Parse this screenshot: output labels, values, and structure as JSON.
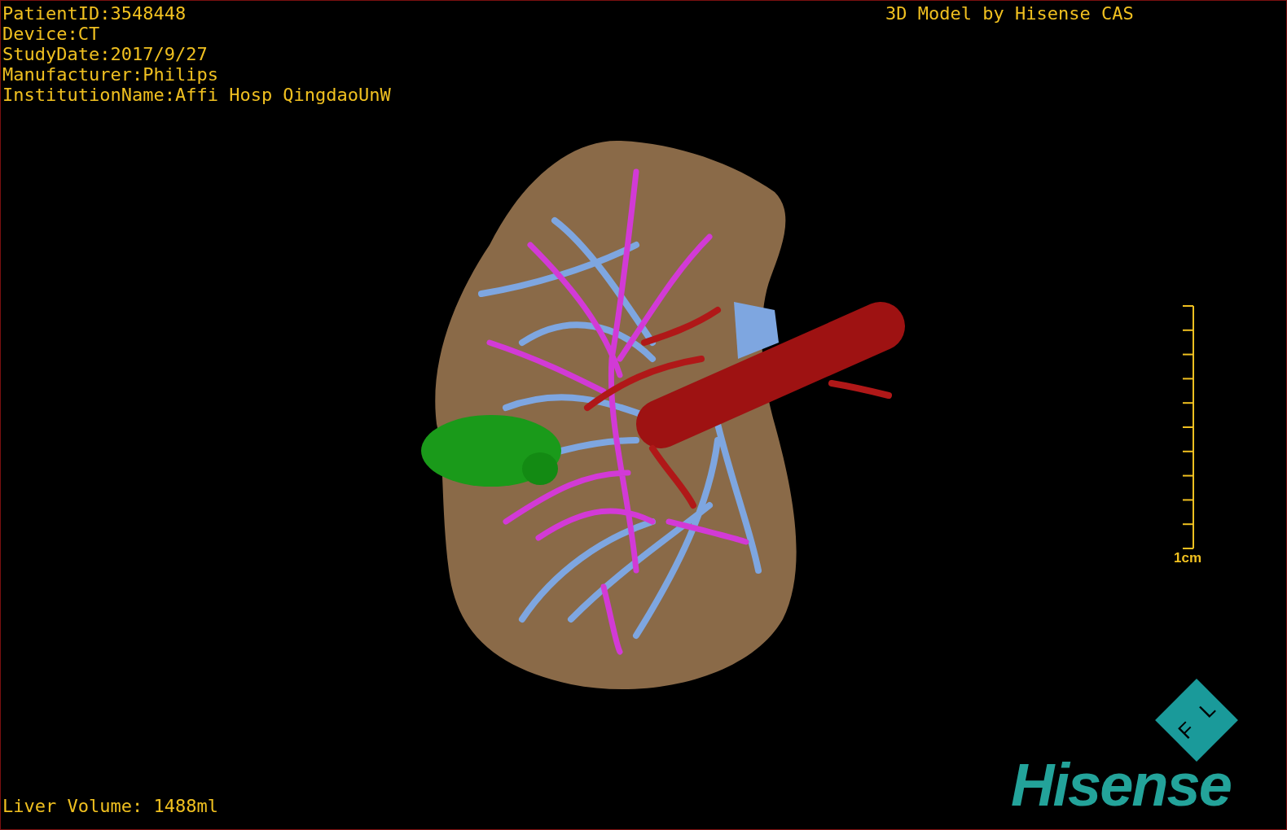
{
  "patient_info": [
    "PatientID:3548448",
    "Device:CT",
    "StudyDate:2017/9/27",
    "Manufacturer:Philips",
    "InstitutionName:Affi Hosp QingdaoUnW"
  ],
  "title": "3D Model by Hisense CAS",
  "scale_bar": {
    "label": "1cm"
  },
  "orientation_cube": {
    "faces": [
      "F",
      "L"
    ]
  },
  "logo": "Hisense",
  "liver_volume": "Liver Volume: 1488ml"
}
